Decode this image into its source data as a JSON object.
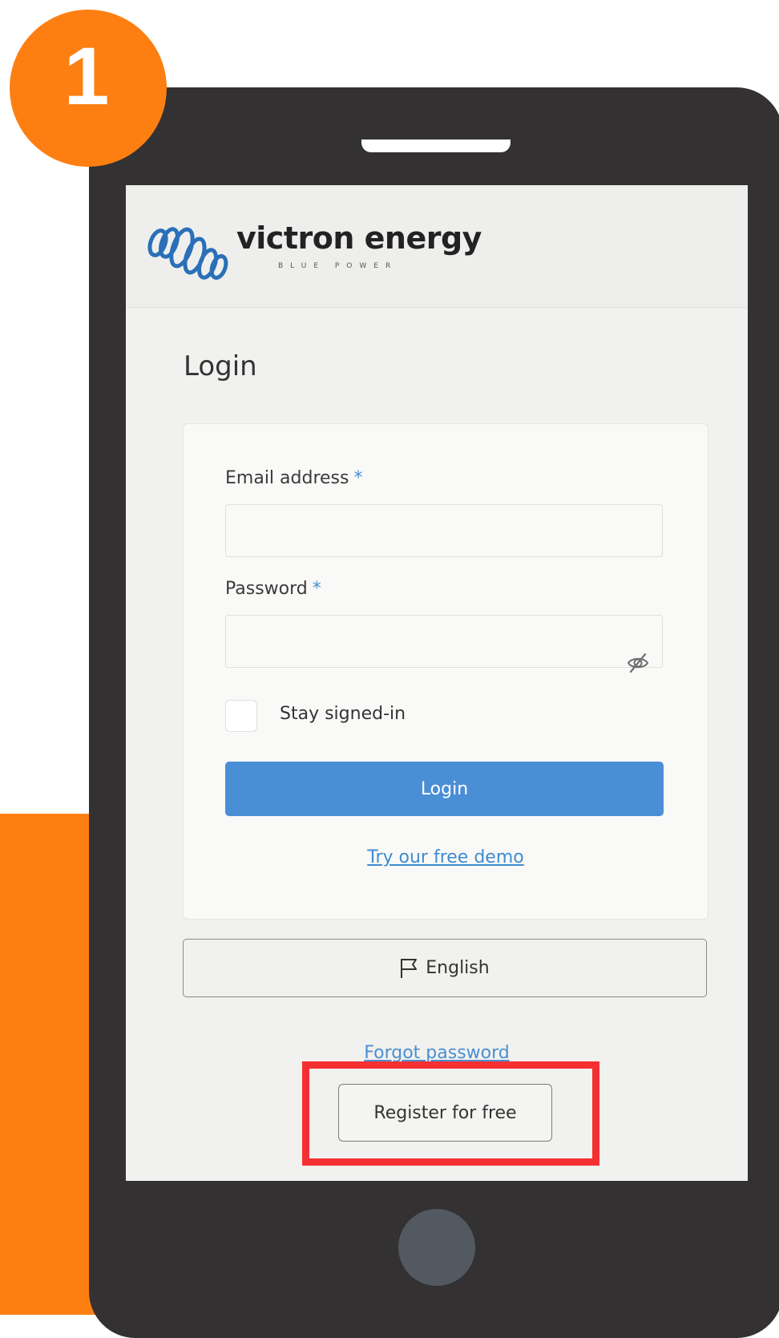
{
  "step": {
    "number": "1"
  },
  "brand": {
    "name": "victron energy",
    "tagline": "BLUE POWER"
  },
  "login": {
    "heading": "Login",
    "email_label": "Email address",
    "email_value": "",
    "password_label": "Password",
    "password_value": "",
    "required_mark": "*",
    "stay_signed_in_label": "Stay signed-in",
    "stay_signed_in_checked": false,
    "login_button_label": "Login",
    "demo_link_label": "Try our free demo"
  },
  "language": {
    "selected": "English",
    "icon": "flag-icon"
  },
  "forgot_password_label": "Forgot password",
  "register_button_label": "Register for free",
  "colors": {
    "accent_orange": "#fd7f12",
    "primary_blue": "#4a8ed6",
    "highlight_red": "#f53032",
    "phone_body": "#333131"
  }
}
